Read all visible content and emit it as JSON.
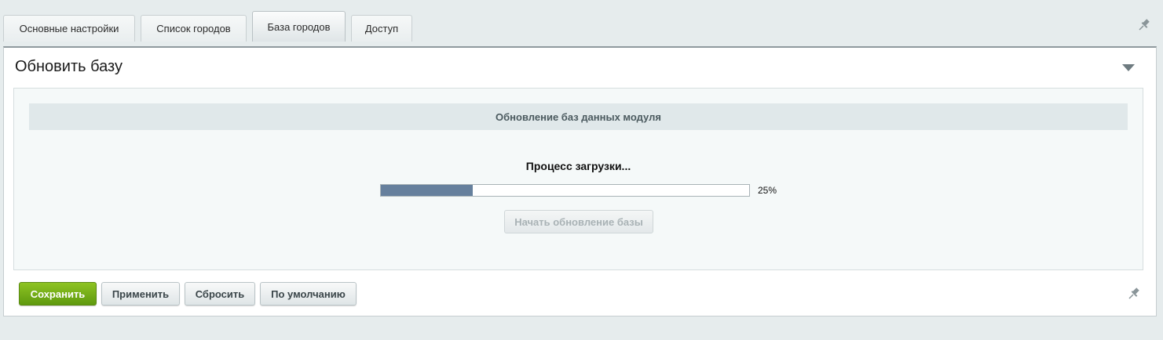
{
  "tabs": [
    {
      "label": "Основные настройки",
      "active": false
    },
    {
      "label": "Список городов",
      "active": false
    },
    {
      "label": "База городов",
      "active": true
    },
    {
      "label": "Доступ",
      "active": false
    }
  ],
  "panel": {
    "title": "Обновить базу",
    "section_header": "Обновление баз данных модуля",
    "process_label": "Процесс загрузки...",
    "progress": {
      "value": 25,
      "label": "25%"
    },
    "start_button_label": "Начать обновление базы"
  },
  "footer": {
    "save_label": "Сохранить",
    "apply_label": "Применить",
    "reset_label": "Сбросить",
    "default_label": "По умолчанию"
  },
  "icons": {
    "pin": "pin-icon",
    "collapse": "chevron-down-icon"
  },
  "colors": {
    "accent_green": "#6eab14",
    "progress_fill": "#66809d"
  }
}
